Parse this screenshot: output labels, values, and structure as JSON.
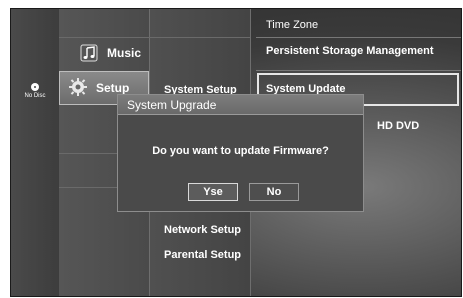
{
  "disc": {
    "label": "No Disc"
  },
  "menu": {
    "items": [
      {
        "label": "Music",
        "icon": "music-note-icon"
      },
      {
        "label": "Setup",
        "icon": "gear-icon"
      }
    ],
    "selected": "Setup"
  },
  "submenu": {
    "items": [
      "System Setup",
      "Network Setup",
      "Parental Setup"
    ]
  },
  "right_panel": {
    "items": [
      "Time Zone",
      "Persistent Storage Management",
      "System Update",
      "HD DVD"
    ],
    "selected": "System Update"
  },
  "dialog": {
    "title": "System Upgrade",
    "message": "Do you want to update Firmware?",
    "yes_label": "Yse",
    "no_label": "No"
  }
}
